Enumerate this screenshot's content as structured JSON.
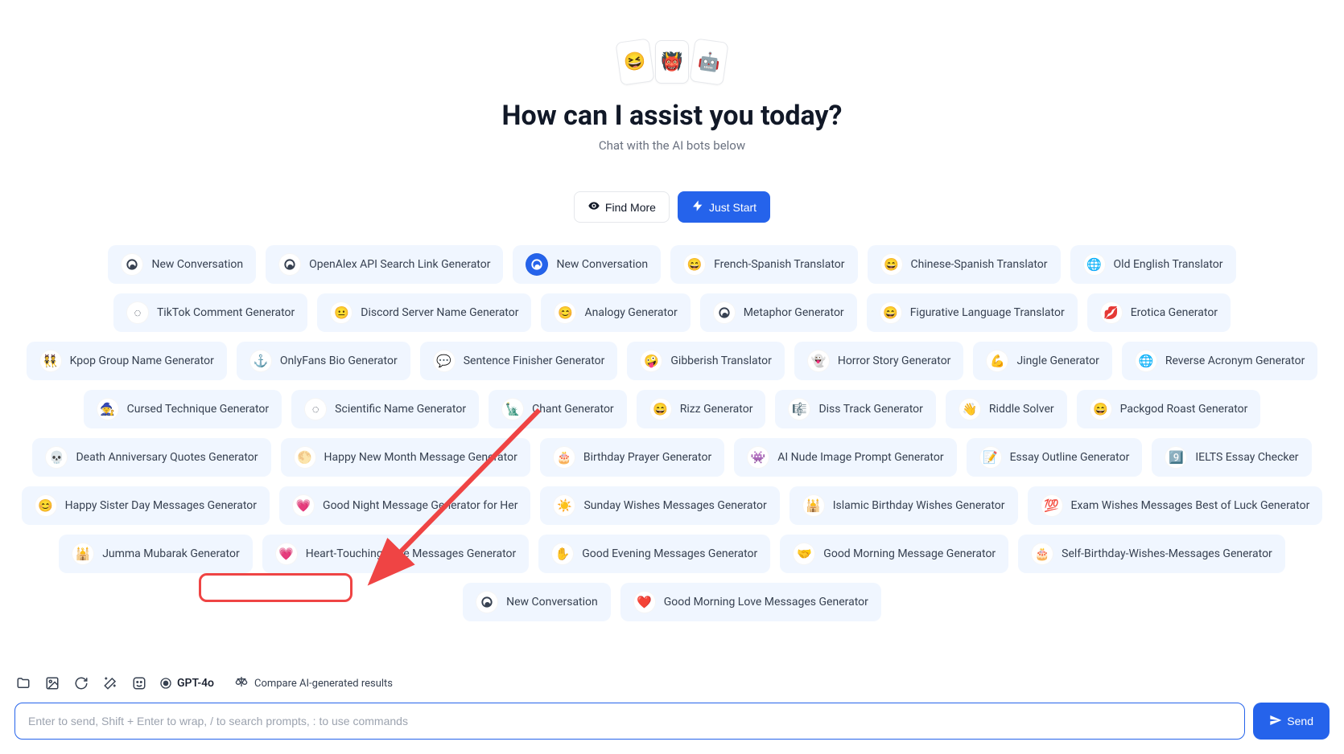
{
  "hero": {
    "emojis": [
      "😆",
      "👹",
      "🤖"
    ],
    "title": "How can I assist you today?",
    "subtitle": "Chat with the AI bots below",
    "find_more": "Find More",
    "just_start": "Just Start"
  },
  "bots": [
    {
      "icon": "swirl",
      "label": "New Conversation"
    },
    {
      "icon": "swirl",
      "label": "OpenAlex API Search Link Generator"
    },
    {
      "icon": "swirl-blue",
      "label": "New Conversation"
    },
    {
      "icon": "😄",
      "label": "French-Spanish Translator"
    },
    {
      "icon": "😄",
      "label": "Chinese-Spanish Translator"
    },
    {
      "icon": "🌐",
      "label": "Old English Translator"
    },
    {
      "icon": "◌",
      "label": "TikTok Comment Generator"
    },
    {
      "icon": "😐",
      "label": "Discord Server Name Generator"
    },
    {
      "icon": "😊",
      "label": "Analogy Generator"
    },
    {
      "icon": "swirl",
      "label": "Metaphor Generator"
    },
    {
      "icon": "😄",
      "label": "Figurative Language Translator"
    },
    {
      "icon": "💋",
      "label": "Erotica Generator"
    },
    {
      "icon": "👯",
      "label": "Kpop Group Name Generator"
    },
    {
      "icon": "⚓",
      "label": "OnlyFans Bio Generator"
    },
    {
      "icon": "💬",
      "label": "Sentence Finisher Generator"
    },
    {
      "icon": "🤪",
      "label": "Gibberish Translator"
    },
    {
      "icon": "👻",
      "label": "Horror Story Generator"
    },
    {
      "icon": "💪",
      "label": "Jingle Generator"
    },
    {
      "icon": "🌐",
      "label": "Reverse Acronym Generator"
    },
    {
      "icon": "🧙",
      "label": "Cursed Technique Generator"
    },
    {
      "icon": "◌",
      "label": "Scientific Name Generator"
    },
    {
      "icon": "🗽",
      "label": "Chant Generator"
    },
    {
      "icon": "😄",
      "label": "Rizz Generator"
    },
    {
      "icon": "🎼",
      "label": "Diss Track Generator"
    },
    {
      "icon": "👋",
      "label": "Riddle Solver"
    },
    {
      "icon": "😄",
      "label": "Packgod Roast Generator"
    },
    {
      "icon": "💀",
      "label": "Death Anniversary Quotes Generator"
    },
    {
      "icon": "🌕",
      "label": "Happy New Month Message Generator"
    },
    {
      "icon": "🎂",
      "label": "Birthday Prayer Generator"
    },
    {
      "icon": "👾",
      "label": "AI Nude Image Prompt Generator"
    },
    {
      "icon": "📝",
      "label": "Essay Outline Generator"
    },
    {
      "icon": "9️⃣",
      "label": "IELTS Essay Checker"
    },
    {
      "icon": "😊",
      "label": "Happy Sister Day Messages Generator"
    },
    {
      "icon": "💗",
      "label": "Good Night Message Generator for Her"
    },
    {
      "icon": "☀️",
      "label": "Sunday Wishes Messages Generator"
    },
    {
      "icon": "🕌",
      "label": "Islamic Birthday Wishes Generator"
    },
    {
      "icon": "💯",
      "label": "Exam Wishes Messages Best of Luck Generator"
    },
    {
      "icon": "🕌",
      "label": "Jumma Mubarak Generator"
    },
    {
      "icon": "💗",
      "label": "Heart-Touching Love Messages Generator"
    },
    {
      "icon": "✋",
      "label": "Good Evening Messages Generator"
    },
    {
      "icon": "🤝",
      "label": "Good Morning Message Generator"
    },
    {
      "icon": "🎂",
      "label": "Self-Birthday-Wishes-Messages Generator"
    },
    {
      "icon": "swirl",
      "label": "New Conversation"
    },
    {
      "icon": "❤️",
      "label": "Good Morning Love Messages Generator"
    }
  ],
  "toolbar": {
    "model": "GPT-4o",
    "compare": "Compare AI-generated results"
  },
  "input": {
    "placeholder": "Enter to send, Shift + Enter to wrap, / to search prompts, : to use commands",
    "send": "Send"
  }
}
